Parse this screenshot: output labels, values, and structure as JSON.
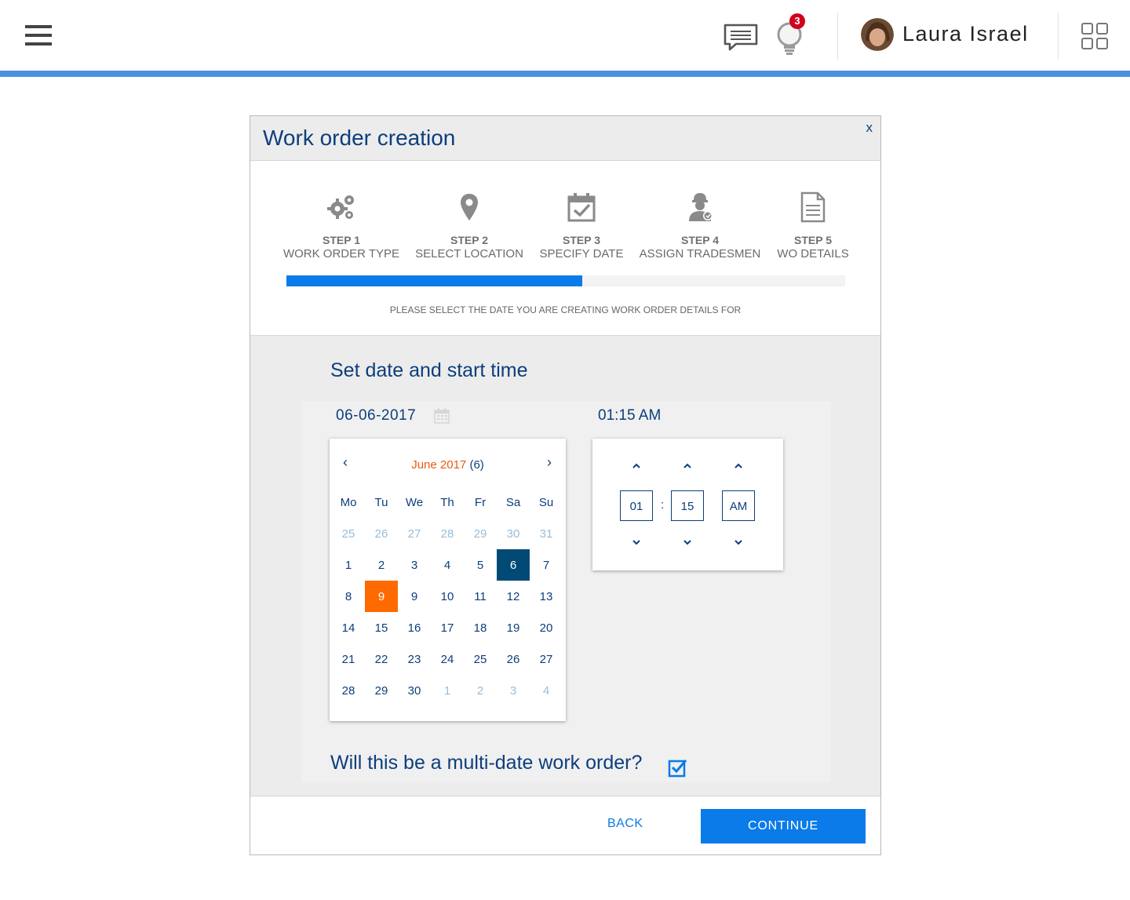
{
  "topbar": {
    "notification_count": "3",
    "user_name": "Laura Israel",
    "accent_color": "#4a8fe0"
  },
  "modal": {
    "title": "Work order creation",
    "close_label": "x",
    "steps": [
      {
        "num": "STEP 1",
        "label": "WORK ORDER TYPE",
        "icon": "gears-icon"
      },
      {
        "num": "STEP 2",
        "label": "SELECT LOCATION",
        "icon": "map-pin-icon"
      },
      {
        "num": "STEP 3",
        "label": "SPECIFY DATE",
        "icon": "calendar-check-icon"
      },
      {
        "num": "STEP 4",
        "label": "ASSIGN TRADESMEN",
        "icon": "worker-icon"
      },
      {
        "num": "STEP 5",
        "label": "WO DETAILS",
        "icon": "document-icon"
      }
    ],
    "progress_fraction": 0.53,
    "instruction": "PLEASE SELECT THE DATE YOU ARE CREATING WORK ORDER DETAILS FOR",
    "section_title": "Set date and start time",
    "date_value": "06-06-2017",
    "time_value": "01:15 AM",
    "calendar": {
      "prev": "‹",
      "next": "›",
      "month_name": "June 2017",
      "month_count": " (6)",
      "weekdays": [
        "Mo",
        "Tu",
        "We",
        "Th",
        "Fr",
        "Sa",
        "Su"
      ],
      "weeks": [
        [
          "25",
          "26",
          "27",
          "28",
          "29",
          "30",
          "31"
        ],
        [
          "1",
          "2",
          "3",
          "4",
          "5",
          "6",
          "7"
        ],
        [
          "8",
          "9",
          "9",
          "10",
          "11",
          "12",
          "13"
        ],
        [
          "14",
          "15",
          "16",
          "17",
          "18",
          "19",
          "20"
        ],
        [
          "21",
          "22",
          "23",
          "24",
          "25",
          "26",
          "27"
        ],
        [
          "28",
          "29",
          "30",
          "1",
          "2",
          "3",
          "4"
        ]
      ],
      "selected_color": "#004a75",
      "today_color": "#ff6a00"
    },
    "timepicker": {
      "hour": "01",
      "separator": ":",
      "minute": "15",
      "period": "AM"
    },
    "multi_date_question": "Will this be a multi-date work order?",
    "multi_date_checked": true,
    "back_label": "BACK",
    "continue_label": "CONTINUE",
    "primary_color": "#0a7be8",
    "heading_color": "#0d3e7d"
  }
}
